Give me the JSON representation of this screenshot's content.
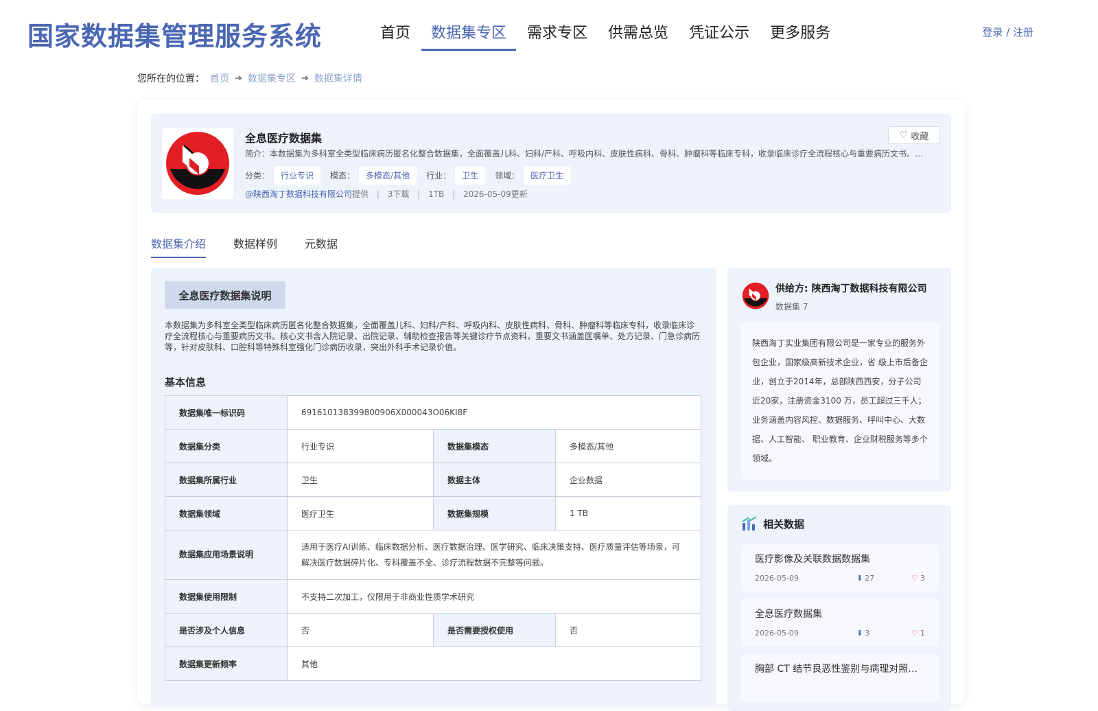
{
  "header": {
    "title": "国家数据集管理服务系统",
    "nav": [
      "首页",
      "数据集专区",
      "需求专区",
      "供需总览",
      "凭证公示",
      "更多服务"
    ],
    "active_nav": "数据集专区",
    "login": "登录 / 注册"
  },
  "breadcrumb": {
    "prefix": "您所在的位置：",
    "items": [
      "首页",
      "数据集专区",
      "数据集详情"
    ]
  },
  "dataset": {
    "name": "全息医疗数据集",
    "intro": "简介：本数据集为多科室全类型临床病历匿名化整合数据集，全面覆盖儿科、妇科/产科、呼吸内科、皮肤性病科、骨科、肿瘤科等临床专科，收录临床诊疗全流程核心与重要病历文书。核心文书含入院记录、出院记录、辅助检查报告等关键诊疗节点资料",
    "favorite": "收藏",
    "tags": [
      {
        "label": "分类：",
        "value": "行业专识"
      },
      {
        "label": "模态：",
        "value": "多模态/其他"
      },
      {
        "label": "行业：",
        "value": "卫生"
      },
      {
        "label": "领域：",
        "value": "医疗卫生"
      }
    ],
    "provider": "@陕西淘丁数据科技有限公司",
    "provided_suffix": "提供",
    "downloads": "3下载",
    "size": "1TB",
    "updated": "2026-05-09更新"
  },
  "tabs": [
    "数据集介绍",
    "数据样例",
    "元数据"
  ],
  "active_tab": "数据集介绍",
  "intro_section": {
    "title": "全息医疗数据集说明",
    "description": "本数据集为多科室全类型临床病历匿名化整合数据集，全面覆盖儿科、妇科/产科、呼吸内科、皮肤性病科、骨科、肿瘤科等临床专科，收录临床诊疗全流程核心与重要病历文书。核心文书含入院记录、出院记录、辅助检查报告等关键诊疗节点资料，重要文书涵盖医嘱单、处方记录、门急诊病历等，针对皮肤科、口腔科等特殊科室强化门诊病历收录，突出外科手术记录价值。",
    "basic_title": "基本信息"
  },
  "basic_info": {
    "id_label": "数据集唯一标识码",
    "id_value": "691610138399800906X000043O06KI8F",
    "category_label": "数据集分类",
    "category_value": "行业专识",
    "modality_label": "数据集模态",
    "modality_value": "多模态/其他",
    "industry_label": "数据集所属行业",
    "industry_value": "卫生",
    "subject_label": "数据主体",
    "subject_value": "企业数据",
    "domain_label": "数据集领域",
    "domain_value": "医疗卫生",
    "scale_label": "数据集规模",
    "scale_value": "1 TB",
    "scenario_label": "数据集应用场景说明",
    "scenario_value": "适用于医疗AI训练、临床数据分析、医疗数据治理、医学研究、临床决策支持、医疗质量评估等场景，可解决医疗数据碎片化、专科覆盖不全、诊疗流程数据不完整等问题。",
    "restriction_label": "数据集使用限制",
    "restriction_value": "不支持二次加工，仅限用于非商业性质学术研究",
    "personal_label": "是否涉及个人信息",
    "personal_value": "否",
    "auth_label": "是否需要授权使用",
    "auth_value": "否",
    "frequency_label": "数据集更新频率",
    "frequency_value": "其他"
  },
  "supplier": {
    "name": "供给方: 陕西淘丁数据科技有限公司",
    "count": "数据集 7",
    "description": "陕西淘丁实业集团有限公司是一家专业的服务外包企业，国家级高新技术企业，省 级上市后备企业，创立于2014年，总部陕西西安，分子公司近20家，注册资金3100 万，员工超过三千人；业务涵盖内容风控、数据服务、呼叫中心、大数据、人工智能、 职业教育、企业财税服务等多个领域。"
  },
  "related": {
    "title": "相关数据",
    "items": [
      {
        "name": "医疗影像及关联数据数据集",
        "date": "2026-05-09",
        "downloads": "27",
        "likes": "3"
      },
      {
        "name": "全息医疗数据集",
        "date": "2026-05-09",
        "downloads": "3",
        "likes": "1"
      },
      {
        "name": "胸部 CT 结节良恶性鉴别与病理对照数据集",
        "date": "",
        "downloads": "",
        "likes": ""
      }
    ]
  },
  "colors": {
    "brand": "#4b67b3",
    "panel_bg": "#eef2fb",
    "logo_red": "#e31e24",
    "logo_black": "#111111"
  }
}
